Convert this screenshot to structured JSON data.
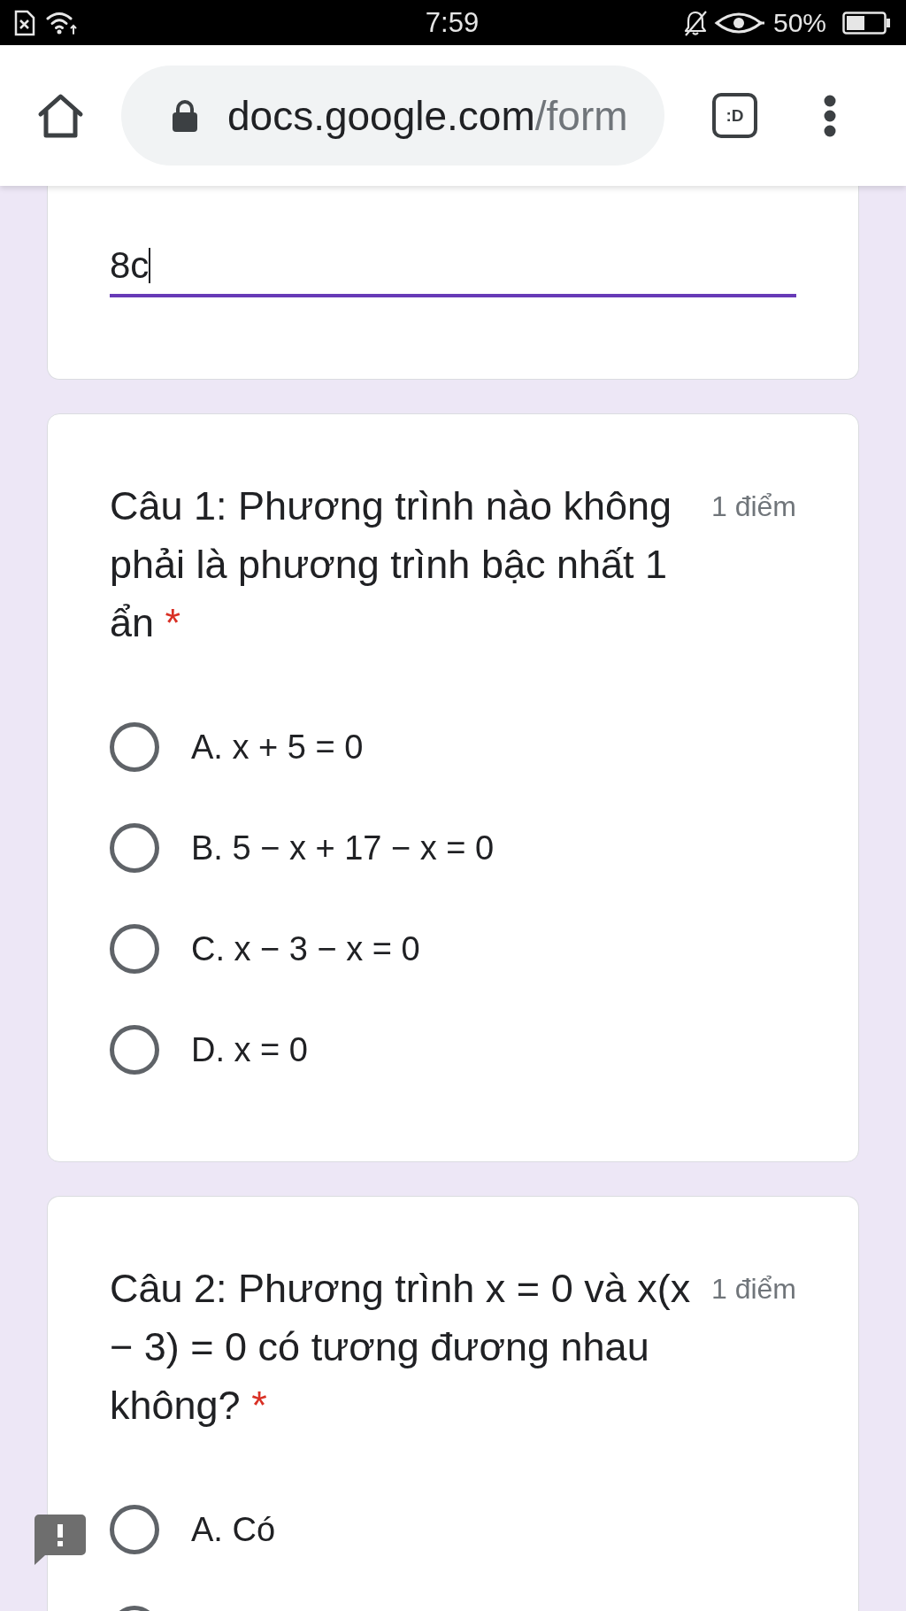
{
  "status_bar": {
    "time": "7:59",
    "battery_text": "50%"
  },
  "browser_toolbar": {
    "url": {
      "host": "docs.google.com",
      "path": "/form"
    },
    "tab_count": ":D"
  },
  "answer_card": {
    "value": "8c",
    "focused": true
  },
  "questions": [
    {
      "title": "Câu 1: Phương trình nào không phải là phương trình bậc nhất 1 ẩn",
      "required_mark": "*",
      "points": "1 điểm",
      "options": [
        {
          "label": "A. x + 5 = 0",
          "selected": false
        },
        {
          "label": "B. 5 − x + 17 − x = 0",
          "selected": false
        },
        {
          "label": "C. x − 3 − x = 0",
          "selected": false
        },
        {
          "label": "D. x = 0",
          "selected": false
        }
      ]
    },
    {
      "title": "Câu 2: Phương trình x = 0 và x(x − 3) = 0 có tương đương nhau không?",
      "required_mark": "*",
      "points": "1 điểm",
      "options": [
        {
          "label": "A. Có",
          "selected": false
        },
        {
          "selected": false
        }
      ]
    }
  ]
}
